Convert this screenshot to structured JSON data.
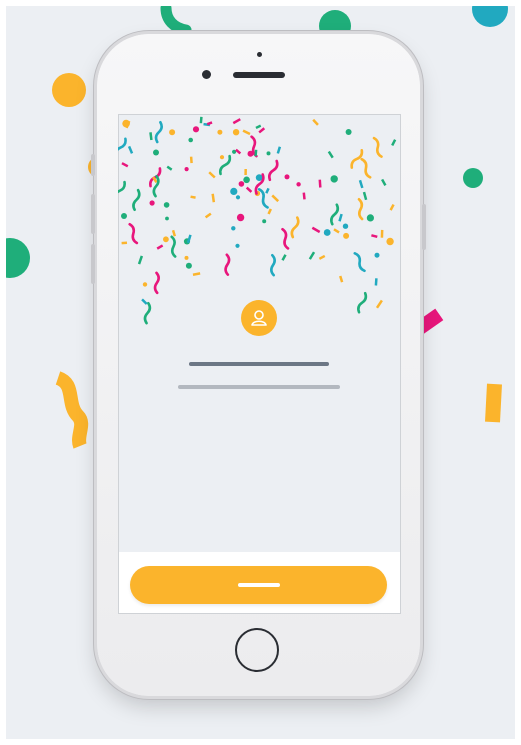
{
  "scene": {
    "description_free": true,
    "colors": {
      "background": "#eceff3",
      "yellow": "#fbb42c",
      "green": "#1fae7a",
      "teal": "#21a9c0",
      "pink": "#e8167c",
      "dark_line": "#6c7785",
      "light_line": "#b3b8bf"
    },
    "icons": {
      "avatar": "user-icon",
      "home": "home-button-icon"
    }
  }
}
